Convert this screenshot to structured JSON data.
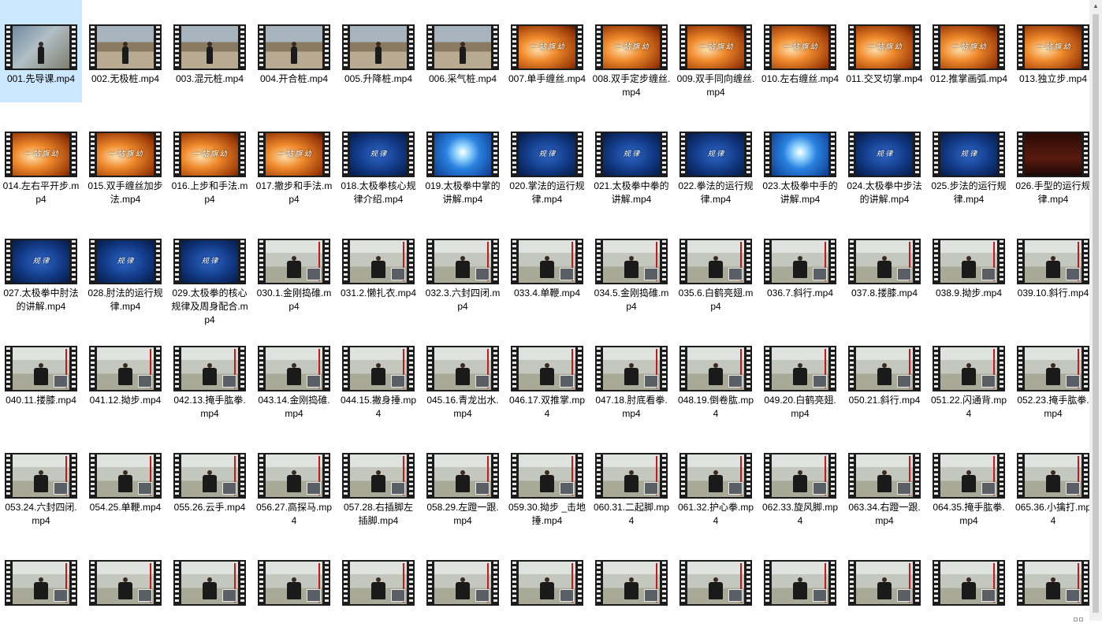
{
  "items": [
    {
      "label": "001.先导课.mp4",
      "thumb": "intro"
    },
    {
      "label": "002.无极桩.mp4",
      "thumb": "road"
    },
    {
      "label": "003.混元桩.mp4",
      "thumb": "road"
    },
    {
      "label": "004.开合桩.mp4",
      "thumb": "road"
    },
    {
      "label": "005.升降桩.mp4",
      "thumb": "road"
    },
    {
      "label": "006.采气桩.mp4",
      "thumb": "road"
    },
    {
      "label": "007.单手缠丝.mp4",
      "thumb": "orange"
    },
    {
      "label": "008.双手定步缠丝.mp4",
      "thumb": "orange"
    },
    {
      "label": "009.双手同向缠丝.mp4",
      "thumb": "orange"
    },
    {
      "label": "010.左右缠丝.mp4",
      "thumb": "orange"
    },
    {
      "label": "011.交叉切掌.mp4",
      "thumb": "orange"
    },
    {
      "label": "012.推掌画弧.mp4",
      "thumb": "orange"
    },
    {
      "label": "013.独立步.mp4",
      "thumb": "orange"
    },
    {
      "label": "014.左右平开步.mp4",
      "thumb": "orange"
    },
    {
      "label": "015.双手缠丝加步法.mp4",
      "thumb": "orange"
    },
    {
      "label": "016.上步和手法.mp4",
      "thumb": "orange"
    },
    {
      "label": "017.撤步和手法.mp4",
      "thumb": "orange"
    },
    {
      "label": "018.太极拳核心规律介绍.mp4",
      "thumb": "blue"
    },
    {
      "label": "019.太极拳中掌的讲解.mp4",
      "thumb": "burst"
    },
    {
      "label": "020.掌法的运行规律.mp4",
      "thumb": "blue"
    },
    {
      "label": "021.太极拳中拳的讲解.mp4",
      "thumb": "blue"
    },
    {
      "label": "022.拳法的运行规律.mp4",
      "thumb": "blue"
    },
    {
      "label": "023.太极拳中手的讲解.mp4",
      "thumb": "burst"
    },
    {
      "label": "024.太极拳中步法的讲解.mp4",
      "thumb": "blue"
    },
    {
      "label": "025.步法的运行规律.mp4",
      "thumb": "blue"
    },
    {
      "label": "026.手型的运行规律.mp4",
      "thumb": "dark"
    },
    {
      "label": "027.太极拳中肘法的讲解.mp4",
      "thumb": "blue"
    },
    {
      "label": "028.肘法的运行规律.mp4",
      "thumb": "blue"
    },
    {
      "label": "029.太极拳的核心规律及周身配合.mp4",
      "thumb": "blue"
    },
    {
      "label": "030.1.金刚捣碓.mp4",
      "thumb": "field"
    },
    {
      "label": "031.2.懒扎衣.mp4",
      "thumb": "field"
    },
    {
      "label": "032.3.六封四闭.mp4",
      "thumb": "field"
    },
    {
      "label": "033.4.单鞭.mp4",
      "thumb": "field"
    },
    {
      "label": "034.5.金刚捣碓.mp4",
      "thumb": "field"
    },
    {
      "label": "035.6.白鹤亮翅.mp4",
      "thumb": "field"
    },
    {
      "label": "036.7.斜行.mp4",
      "thumb": "field"
    },
    {
      "label": "037.8.搂膝.mp4",
      "thumb": "field"
    },
    {
      "label": "038.9.拗步.mp4",
      "thumb": "field"
    },
    {
      "label": "039.10.斜行.mp4",
      "thumb": "field"
    },
    {
      "label": "040.11.搂膝.mp4",
      "thumb": "field"
    },
    {
      "label": "041.12.拗步.mp4",
      "thumb": "field"
    },
    {
      "label": "042.13.掩手肱拳.mp4",
      "thumb": "field"
    },
    {
      "label": "043.14.金刚捣碓.mp4",
      "thumb": "field"
    },
    {
      "label": "044.15.撇身捶.mp4",
      "thumb": "field"
    },
    {
      "label": "045.16.青龙出水.mp4",
      "thumb": "field"
    },
    {
      "label": "046.17.双推掌.mp4",
      "thumb": "field"
    },
    {
      "label": "047.18.肘底看拳.mp4",
      "thumb": "field"
    },
    {
      "label": "048.19.倒卷肱.mp4",
      "thumb": "field"
    },
    {
      "label": "049.20.白鹤亮翅.mp4",
      "thumb": "field"
    },
    {
      "label": "050.21.斜行.mp4",
      "thumb": "field"
    },
    {
      "label": "051.22.闪通背.mp4",
      "thumb": "field"
    },
    {
      "label": "052.23.掩手肱拳.mp4",
      "thumb": "field"
    },
    {
      "label": "053.24.六封四闭.mp4",
      "thumb": "field"
    },
    {
      "label": "054.25.单鞭.mp4",
      "thumb": "field"
    },
    {
      "label": "055.26.云手.mp4",
      "thumb": "field"
    },
    {
      "label": "056.27.高探马.mp4",
      "thumb": "field"
    },
    {
      "label": "057.28.右插脚左插脚.mp4",
      "thumb": "field"
    },
    {
      "label": "058.29.左蹬一跟.mp4",
      "thumb": "field"
    },
    {
      "label": "059.30.拗步 _击地捶.mp4",
      "thumb": "field"
    },
    {
      "label": "060.31.二起脚.mp4",
      "thumb": "field"
    },
    {
      "label": "061.32.护心拳.mp4",
      "thumb": "field"
    },
    {
      "label": "062.33.旋风脚.mp4",
      "thumb": "field"
    },
    {
      "label": "063.34.右蹬一跟.mp4",
      "thumb": "field"
    },
    {
      "label": "064.35.掩手肱拳.mp4",
      "thumb": "field"
    },
    {
      "label": "065.36.小擒打.mp4",
      "thumb": "field"
    },
    {
      "label": "",
      "thumb": "field"
    },
    {
      "label": "",
      "thumb": "field"
    },
    {
      "label": "",
      "thumb": "field"
    },
    {
      "label": "",
      "thumb": "field"
    },
    {
      "label": "",
      "thumb": "field"
    },
    {
      "label": "",
      "thumb": "field"
    },
    {
      "label": "",
      "thumb": "field"
    },
    {
      "label": "",
      "thumb": "field"
    },
    {
      "label": "",
      "thumb": "field"
    },
    {
      "label": "",
      "thumb": "field"
    },
    {
      "label": "",
      "thumb": "field"
    },
    {
      "label": "",
      "thumb": "field"
    },
    {
      "label": "",
      "thumb": "field"
    }
  ],
  "selected_index": 0,
  "thumb_overlay_text": {
    "orange": "一 站 旗 幼",
    "blue": "规 律"
  },
  "scrollbar": {
    "up_icon": "scroll-up-arrow-icon"
  }
}
